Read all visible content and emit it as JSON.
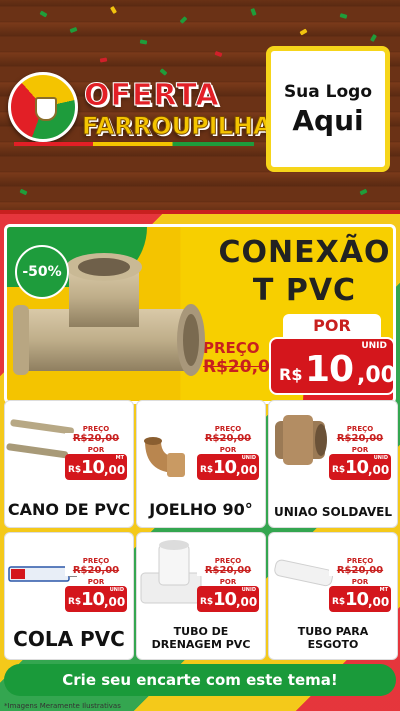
{
  "header": {
    "title_line1": "OFERTA",
    "title_line2": "FARROUPILHA",
    "logo_line1": "Sua Logo",
    "logo_line2": "Aqui"
  },
  "hero": {
    "discount": "-50%",
    "title_line1": "CONEXÃO",
    "title_line2": "T PVC",
    "por": "POR",
    "preco": "PREÇO",
    "old_price": "R$20,00",
    "currency": "R$",
    "price_int": "10",
    "price_cents": ",00",
    "unit": "UNID"
  },
  "products": [
    {
      "name": "CANO DE PVC",
      "preco": "PREÇO",
      "old": "R$20,00",
      "por": "POR",
      "cur": "R$",
      "int": "10",
      "cents": ",00",
      "unit": "MT"
    },
    {
      "name": "JOELHO 90°",
      "preco": "PREÇO",
      "old": "R$20,00",
      "por": "POR",
      "cur": "R$",
      "int": "10",
      "cents": ",00",
      "unit": "UNID"
    },
    {
      "name": "UNIAO SOLDAVEL",
      "preco": "PREÇO",
      "old": "R$20,00",
      "por": "POR",
      "cur": "R$",
      "int": "10",
      "cents": ",00",
      "unit": "UNID"
    },
    {
      "name": "COLA PVC",
      "preco": "PREÇO",
      "old": "R$20,00",
      "por": "POR",
      "cur": "R$",
      "int": "10",
      "cents": ",00",
      "unit": "UNID"
    },
    {
      "name_line1": "TUBO DE",
      "name_line2": "DRENAGEM PVC",
      "preco": "PREÇO",
      "old": "R$20,00",
      "por": "POR",
      "cur": "R$",
      "int": "10",
      "cents": ",00",
      "unit": "UNID"
    },
    {
      "name_line1": "TUBO PARA",
      "name_line2": "ESGOTO",
      "preco": "PREÇO",
      "old": "R$20,00",
      "por": "POR",
      "cur": "R$",
      "int": "10",
      "cents": ",00",
      "unit": "MT"
    }
  ],
  "footer": {
    "cta": "Crie seu encarte com este tema!",
    "disclaimer": "*Imagens Meramente Ilustrativas"
  },
  "colors": {
    "red": "#d4161c",
    "yellow": "#f4c400",
    "green": "#1e9c3c",
    "wood": "#6b3216"
  }
}
